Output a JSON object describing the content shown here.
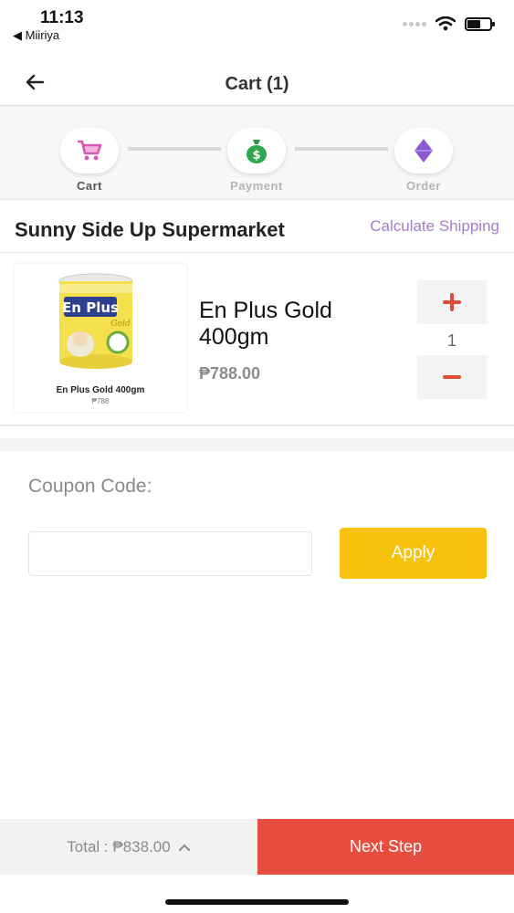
{
  "status_bar": {
    "time": "11:13",
    "back_app": "◀ Miiriya"
  },
  "header": {
    "title": "Cart (1)",
    "back_icon": "arrow-left-icon"
  },
  "steps": [
    {
      "label": "Cart",
      "icon": "shopping-cart-icon",
      "active": true,
      "color": "#d858b4"
    },
    {
      "label": "Payment",
      "icon": "money-bag-icon",
      "active": false,
      "color": "#2fa84f"
    },
    {
      "label": "Order",
      "icon": "diamond-icon",
      "active": false,
      "color": "#8b5bd6"
    }
  ],
  "store": {
    "name": "Sunny Side Up Supermarket",
    "shipping_link": "Calculate Shipping"
  },
  "cart_items": [
    {
      "name": "En Plus Gold 400gm",
      "price": "₱788.00",
      "quantity": "1",
      "thumbnail": {
        "brand": "En Plus",
        "sub_brand": "Gold",
        "caption": "En Plus Gold 400gm",
        "price": "₱788"
      }
    }
  ],
  "coupon": {
    "label": "Coupon Code:",
    "value": "",
    "placeholder": "",
    "apply_label": "Apply"
  },
  "footer": {
    "total": "Total : ₱838.00",
    "next_label": "Next Step"
  },
  "colors": {
    "accent_yellow": "#f7c20d",
    "next_red": "#e84e3f",
    "link_purple": "#a77cc6",
    "qty_red": "#e04a3a"
  }
}
